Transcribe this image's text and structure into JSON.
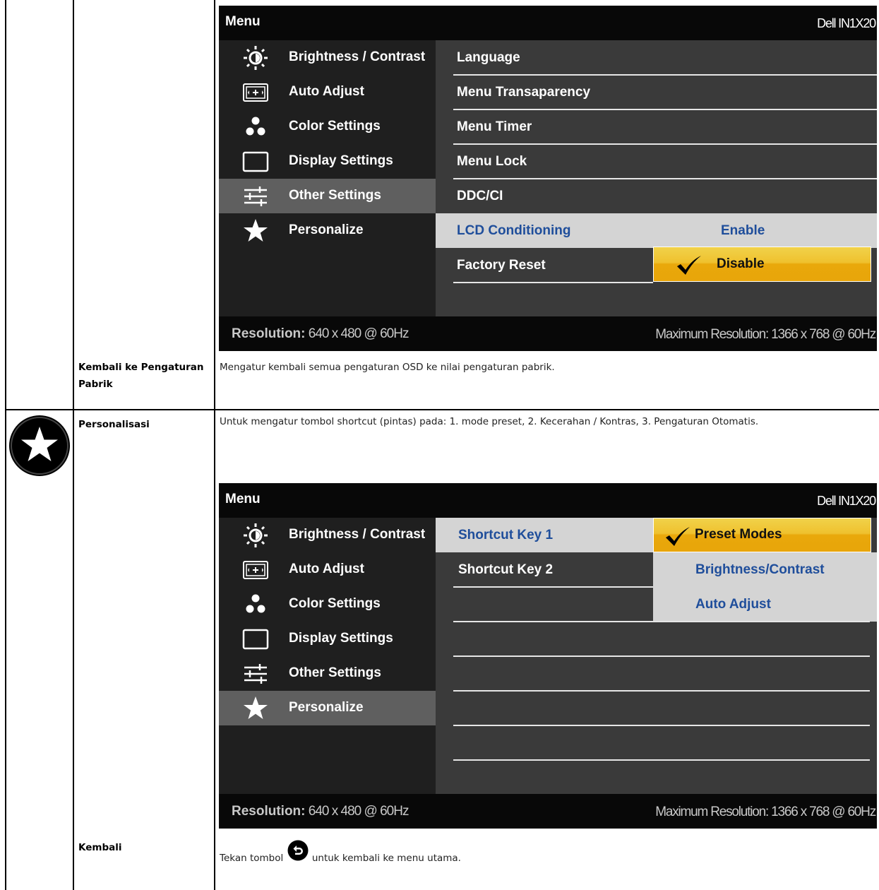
{
  "rows": {
    "factory_reset": {
      "label_line1": "Kembali ke Pengaturan",
      "label_line2": "Pabrik",
      "description": "Mengatur kembali semua pengaturan OSD ke nilai pengaturan pabrik."
    },
    "personalize": {
      "label": "Personalisasi",
      "description": "Untuk mengatur tombol shortcut (pintas) pada: 1. mode preset, 2. Kecerahan / Kontras, 3. Pengaturan Otomatis."
    },
    "back": {
      "label": "Kembali",
      "description_before": "Tekan tombol",
      "description_after": "untuk kembali ke menu utama."
    }
  },
  "osd1": {
    "title": "Menu",
    "model": "Dell IN1X20",
    "menu_items": [
      "Brightness / Contrast",
      "Auto Adjust",
      "Color Settings",
      "Display Settings",
      "Other Settings",
      "Personalize"
    ],
    "selected_menu": "Other Settings",
    "sub_items": [
      "Language",
      "Menu Transaparency",
      "Menu Timer",
      "Menu Lock",
      "DDC/CI",
      "LCD Conditioning",
      "Factory Reset"
    ],
    "highlighted_sub": "LCD Conditioning",
    "options": {
      "enable": "Enable",
      "disable": "Disable"
    },
    "selected_option": "Disable",
    "resolution_label": "Resolution:",
    "resolution_value": "640 x 480 @ 60Hz",
    "max_resolution": "Maximum Resolution: 1366 x 768 @ 60Hz"
  },
  "osd2": {
    "title": "Menu",
    "model": "Dell IN1X20",
    "menu_items": [
      "Brightness / Contrast",
      "Auto Adjust",
      "Color Settings",
      "Display Settings",
      "Other Settings",
      "Personalize"
    ],
    "selected_menu": "Personalize",
    "sub_items": [
      "Shortcut Key 1",
      "Shortcut Key 2"
    ],
    "highlighted_sub": "Shortcut Key 1",
    "options": [
      "Preset Modes",
      "Brightness/Contrast",
      "Auto Adjust"
    ],
    "selected_option": "Preset Modes",
    "resolution_label": "Resolution:",
    "resolution_value": "640 x 480 @ 60Hz",
    "max_resolution": "Maximum Resolution: 1366 x 768 @ 60Hz"
  },
  "icons": {
    "menu": [
      "brightness-icon",
      "auto-adjust-icon",
      "color-settings-icon",
      "display-settings-icon",
      "other-settings-icon",
      "personalize-star-icon"
    ],
    "row_icon": "personalize-star-icon",
    "inline_button": "back-button-icon"
  },
  "colors": {
    "osd_header": "#080808",
    "osd_left_panel": "#1f1f1f",
    "osd_right_panel": "#3a3a3a",
    "selected_item": "#5f5f5f",
    "highlight_bg": "#d4d4d4",
    "highlight_text": "#1f4e9b",
    "selected_option": "#e9a80b"
  }
}
